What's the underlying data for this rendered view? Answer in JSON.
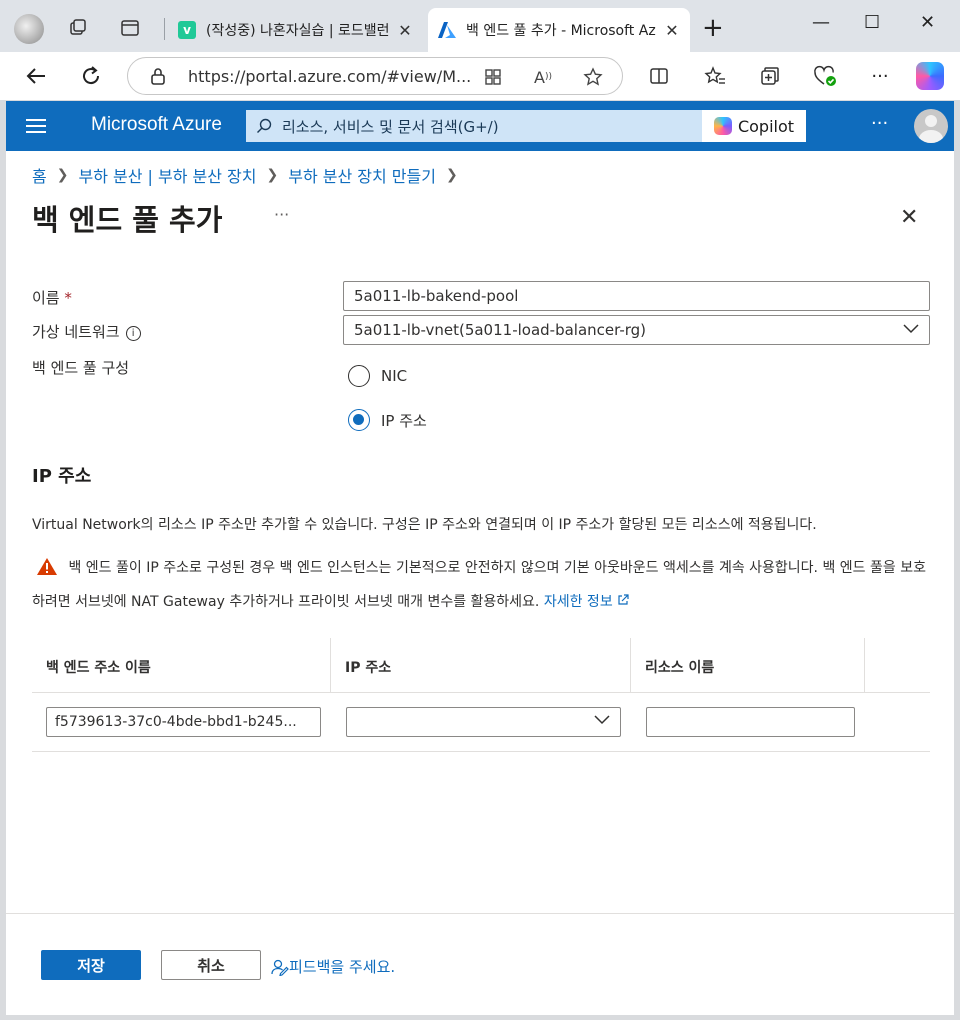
{
  "browser": {
    "tabs": [
      {
        "title": "(작성중) 나혼자실습 | 로드밸런서",
        "favicon_letter": "v",
        "favicon_color": "#20c997"
      },
      {
        "title": "백 엔드 풀 추가 - Microsoft Azure",
        "favicon": "azure-logo"
      }
    ],
    "url": "https://portal.azure.com/#view/M...",
    "new_tab_label": "+",
    "window_controls": {
      "minimize": "—",
      "maximize": "☐",
      "close": "✕"
    }
  },
  "azure_header": {
    "brand": "Microsoft Azure",
    "search_placeholder": "리소스, 서비스 및 문서 검색(G+/)",
    "copilot_label": "Copilot",
    "more_label": "···",
    "header_color": "#0f6cbd"
  },
  "breadcrumb": [
    "홈",
    "부하 분산 | 부하 분산 장치",
    "부하 분산 장치 만들기"
  ],
  "page": {
    "title": "백 엔드 풀 추가",
    "more_label": "···",
    "close_label": "✕"
  },
  "form": {
    "name_label": "이름",
    "required_mark": "*",
    "name_value": "5a011-lb-bakend-pool",
    "vnet_label": "가상 네트워크",
    "info_icon": "i",
    "vnet_value": "5a011-lb-vnet(5a011-load-balancer-rg)",
    "config_label": "백 엔드 풀 구성",
    "options": [
      {
        "label": "NIC",
        "selected": false
      },
      {
        "label": "IP 주소",
        "selected": true
      }
    ]
  },
  "ip_section": {
    "title": "IP 주소",
    "description": "Virtual Network의 리소스 IP 주소만 추가할 수 있습니다. 구성은 IP 주소와 연결되며 이 IP 주소가 할당된 모든 리소스에 적용됩니다.",
    "warning_text": "백 엔드 풀이 IP 주소로 구성된 경우 백 엔드 인스턴스는 기본적으로 안전하지 않으며 기본 아웃바운드 액세스를 계속 사용합니다. 백 엔드 풀을 보호하려면 서브넷에 NAT Gateway 추가하거나 프라이빗 서브넷 매개 변수를 활용하세요.",
    "learn_more": "자세한 정보",
    "warning_color": "#d83b01"
  },
  "table": {
    "headers": [
      "백 엔드 주소 이름",
      "IP 주소",
      "리소스 이름"
    ],
    "rows": [
      {
        "name": "f5739613-37c0-4bde-bbd1-b245...",
        "ip": "",
        "resource": ""
      }
    ]
  },
  "footer": {
    "save_label": "저장",
    "cancel_label": "취소",
    "feedback_label": "피드백을 주세요."
  }
}
